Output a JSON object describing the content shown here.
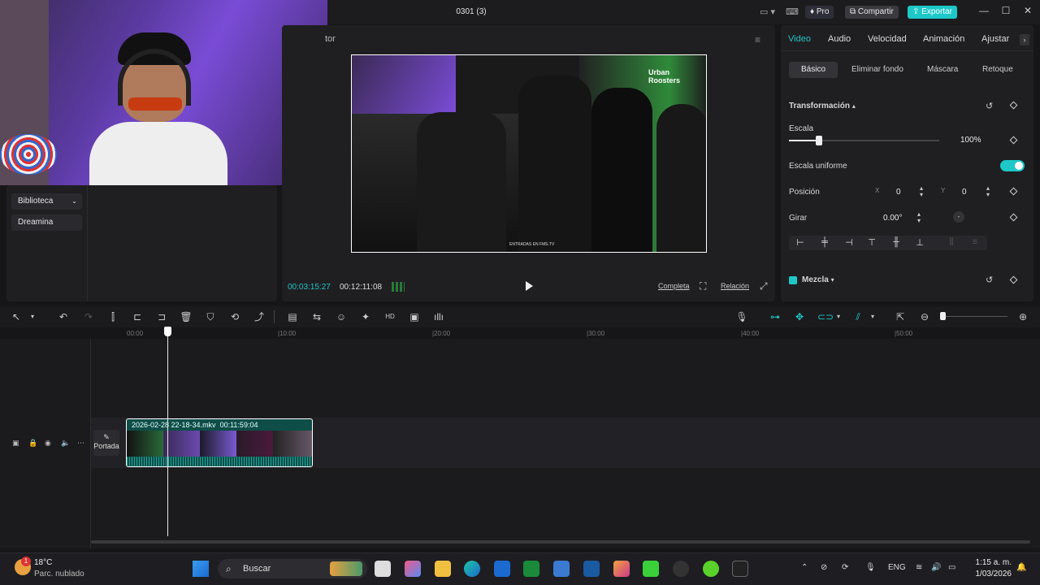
{
  "window": {
    "title": "0301 (3)",
    "pro_label": "Pro",
    "share_label": "Compartir",
    "export_label": "Exportar"
  },
  "left": {
    "nav": [
      "Biblioteca",
      "Dreamina"
    ]
  },
  "player": {
    "label": "tor",
    "current_time": "00:03:15:27",
    "total_time": "00:12:11:08",
    "full_label": "Completa",
    "ratio_label": "Relación",
    "overlay_text": "ENTRADAS EN FMS.TV",
    "logo_text": "Urban Roosters"
  },
  "inspector": {
    "tabs": [
      "Video",
      "Audio",
      "Velocidad",
      "Animación",
      "Ajustar"
    ],
    "subtabs": [
      "Básico",
      "Eliminar fondo",
      "Máscara",
      "Retoque"
    ],
    "transform_label": "Transformación",
    "scale_label": "Escala",
    "scale_value": "100%",
    "scale_fraction": 0.2,
    "uniform_label": "Escala uniforme",
    "position_label": "Posición",
    "x_label": "X",
    "x_value": "0",
    "y_label": "Y",
    "y_value": "0",
    "rotate_label": "Girar",
    "rotate_value": "0.00°",
    "blend_label": "Mezcla"
  },
  "timeline": {
    "ticks": [
      "00:00",
      "|10:00",
      "|20:00",
      "|30:00",
      "|40:00",
      "|50:00"
    ],
    "clip_name": "2026-02-28 22-18-34.mkv",
    "clip_duration": "00:11:59:04",
    "cover_label": "Portada"
  },
  "taskbar": {
    "temp": "18°C",
    "weather": "Parc. nublado",
    "weather_badge": "1",
    "search_placeholder": "Buscar",
    "lang": "ENG",
    "time": "1:15 a. m.",
    "date": "1/03/2026"
  },
  "colors": {
    "accent": "#1ec8c8",
    "bg": "#161618",
    "panel": "#1f1f22"
  }
}
